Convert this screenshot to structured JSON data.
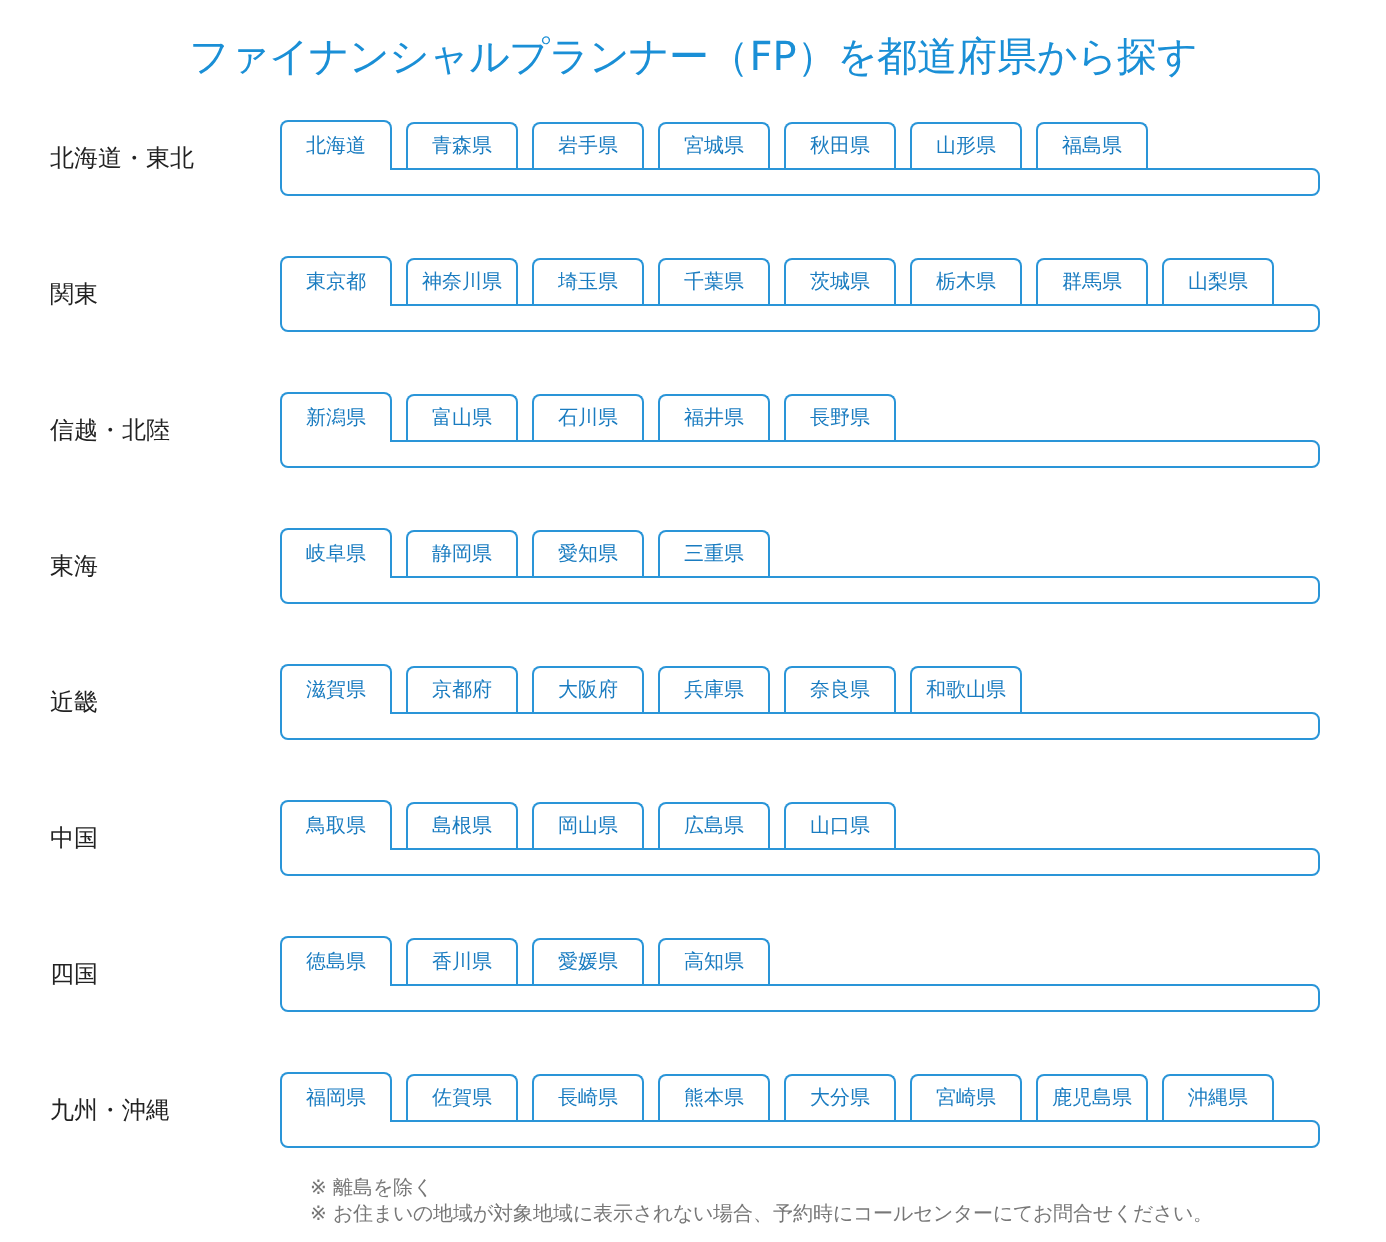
{
  "title": "ファイナンシャルプランナー（FP）を都道府県から探す",
  "regions": [
    {
      "name": "北海道・東北",
      "tabs": [
        {
          "label": "北海道",
          "selected": true
        },
        {
          "label": "青森県",
          "selected": false
        },
        {
          "label": "岩手県",
          "selected": false
        },
        {
          "label": "宮城県",
          "selected": false
        },
        {
          "label": "秋田県",
          "selected": false
        },
        {
          "label": "山形県",
          "selected": false
        },
        {
          "label": "福島県",
          "selected": false
        }
      ]
    },
    {
      "name": "関東",
      "tabs": [
        {
          "label": "東京都",
          "selected": true
        },
        {
          "label": "神奈川県",
          "selected": false
        },
        {
          "label": "埼玉県",
          "selected": false
        },
        {
          "label": "千葉県",
          "selected": false
        },
        {
          "label": "茨城県",
          "selected": false
        },
        {
          "label": "栃木県",
          "selected": false
        },
        {
          "label": "群馬県",
          "selected": false
        },
        {
          "label": "山梨県",
          "selected": false
        }
      ]
    },
    {
      "name": "信越・北陸",
      "tabs": [
        {
          "label": "新潟県",
          "selected": true
        },
        {
          "label": "富山県",
          "selected": false
        },
        {
          "label": "石川県",
          "selected": false
        },
        {
          "label": "福井県",
          "selected": false
        },
        {
          "label": "長野県",
          "selected": false
        }
      ]
    },
    {
      "name": "東海",
      "tabs": [
        {
          "label": "岐阜県",
          "selected": true
        },
        {
          "label": "静岡県",
          "selected": false
        },
        {
          "label": "愛知県",
          "selected": false
        },
        {
          "label": "三重県",
          "selected": false
        }
      ]
    },
    {
      "name": "近畿",
      "tabs": [
        {
          "label": "滋賀県",
          "selected": true
        },
        {
          "label": "京都府",
          "selected": false
        },
        {
          "label": "大阪府",
          "selected": false
        },
        {
          "label": "兵庫県",
          "selected": false
        },
        {
          "label": "奈良県",
          "selected": false
        },
        {
          "label": "和歌山県",
          "selected": false
        }
      ]
    },
    {
      "name": "中国",
      "tabs": [
        {
          "label": "鳥取県",
          "selected": true
        },
        {
          "label": "島根県",
          "selected": false
        },
        {
          "label": "岡山県",
          "selected": false
        },
        {
          "label": "広島県",
          "selected": false
        },
        {
          "label": "山口県",
          "selected": false
        }
      ]
    },
    {
      "name": "四国",
      "tabs": [
        {
          "label": "徳島県",
          "selected": true
        },
        {
          "label": "香川県",
          "selected": false
        },
        {
          "label": "愛媛県",
          "selected": false
        },
        {
          "label": "高知県",
          "selected": false
        }
      ]
    },
    {
      "name": "九州・沖縄",
      "tabs": [
        {
          "label": "福岡県",
          "selected": true
        },
        {
          "label": "佐賀県",
          "selected": false
        },
        {
          "label": "長崎県",
          "selected": false
        },
        {
          "label": "熊本県",
          "selected": false
        },
        {
          "label": "大分県",
          "selected": false
        },
        {
          "label": "宮崎県",
          "selected": false
        },
        {
          "label": "鹿児島県",
          "selected": false
        },
        {
          "label": "沖縄県",
          "selected": false
        }
      ]
    }
  ],
  "notes": [
    "※ 離島を除く",
    "※ お住まいの地域が対象地域に表示されない場合、予約時にコールセンターにてお問合せください。"
  ]
}
